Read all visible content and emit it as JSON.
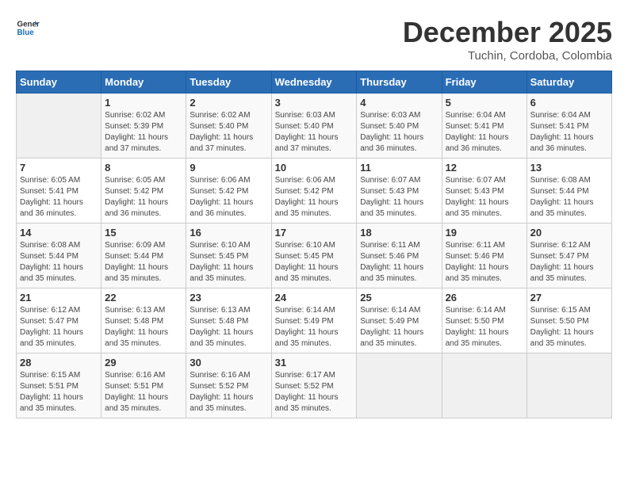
{
  "header": {
    "logo_line1": "General",
    "logo_line2": "Blue",
    "month": "December 2025",
    "location": "Tuchin, Cordoba, Colombia"
  },
  "weekdays": [
    "Sunday",
    "Monday",
    "Tuesday",
    "Wednesday",
    "Thursday",
    "Friday",
    "Saturday"
  ],
  "weeks": [
    [
      {
        "day": "",
        "empty": true
      },
      {
        "day": "1",
        "sunrise": "6:02 AM",
        "sunset": "5:39 PM",
        "daylight": "11 hours and 37 minutes."
      },
      {
        "day": "2",
        "sunrise": "6:02 AM",
        "sunset": "5:40 PM",
        "daylight": "11 hours and 37 minutes."
      },
      {
        "day": "3",
        "sunrise": "6:03 AM",
        "sunset": "5:40 PM",
        "daylight": "11 hours and 37 minutes."
      },
      {
        "day": "4",
        "sunrise": "6:03 AM",
        "sunset": "5:40 PM",
        "daylight": "11 hours and 36 minutes."
      },
      {
        "day": "5",
        "sunrise": "6:04 AM",
        "sunset": "5:41 PM",
        "daylight": "11 hours and 36 minutes."
      },
      {
        "day": "6",
        "sunrise": "6:04 AM",
        "sunset": "5:41 PM",
        "daylight": "11 hours and 36 minutes."
      }
    ],
    [
      {
        "day": "7",
        "sunrise": "6:05 AM",
        "sunset": "5:41 PM",
        "daylight": "11 hours and 36 minutes."
      },
      {
        "day": "8",
        "sunrise": "6:05 AM",
        "sunset": "5:42 PM",
        "daylight": "11 hours and 36 minutes."
      },
      {
        "day": "9",
        "sunrise": "6:06 AM",
        "sunset": "5:42 PM",
        "daylight": "11 hours and 36 minutes."
      },
      {
        "day": "10",
        "sunrise": "6:06 AM",
        "sunset": "5:42 PM",
        "daylight": "11 hours and 35 minutes."
      },
      {
        "day": "11",
        "sunrise": "6:07 AM",
        "sunset": "5:43 PM",
        "daylight": "11 hours and 35 minutes."
      },
      {
        "day": "12",
        "sunrise": "6:07 AM",
        "sunset": "5:43 PM",
        "daylight": "11 hours and 35 minutes."
      },
      {
        "day": "13",
        "sunrise": "6:08 AM",
        "sunset": "5:44 PM",
        "daylight": "11 hours and 35 minutes."
      }
    ],
    [
      {
        "day": "14",
        "sunrise": "6:08 AM",
        "sunset": "5:44 PM",
        "daylight": "11 hours and 35 minutes."
      },
      {
        "day": "15",
        "sunrise": "6:09 AM",
        "sunset": "5:44 PM",
        "daylight": "11 hours and 35 minutes."
      },
      {
        "day": "16",
        "sunrise": "6:10 AM",
        "sunset": "5:45 PM",
        "daylight": "11 hours and 35 minutes."
      },
      {
        "day": "17",
        "sunrise": "6:10 AM",
        "sunset": "5:45 PM",
        "daylight": "11 hours and 35 minutes."
      },
      {
        "day": "18",
        "sunrise": "6:11 AM",
        "sunset": "5:46 PM",
        "daylight": "11 hours and 35 minutes."
      },
      {
        "day": "19",
        "sunrise": "6:11 AM",
        "sunset": "5:46 PM",
        "daylight": "11 hours and 35 minutes."
      },
      {
        "day": "20",
        "sunrise": "6:12 AM",
        "sunset": "5:47 PM",
        "daylight": "11 hours and 35 minutes."
      }
    ],
    [
      {
        "day": "21",
        "sunrise": "6:12 AM",
        "sunset": "5:47 PM",
        "daylight": "11 hours and 35 minutes."
      },
      {
        "day": "22",
        "sunrise": "6:13 AM",
        "sunset": "5:48 PM",
        "daylight": "11 hours and 35 minutes."
      },
      {
        "day": "23",
        "sunrise": "6:13 AM",
        "sunset": "5:48 PM",
        "daylight": "11 hours and 35 minutes."
      },
      {
        "day": "24",
        "sunrise": "6:14 AM",
        "sunset": "5:49 PM",
        "daylight": "11 hours and 35 minutes."
      },
      {
        "day": "25",
        "sunrise": "6:14 AM",
        "sunset": "5:49 PM",
        "daylight": "11 hours and 35 minutes."
      },
      {
        "day": "26",
        "sunrise": "6:14 AM",
        "sunset": "5:50 PM",
        "daylight": "11 hours and 35 minutes."
      },
      {
        "day": "27",
        "sunrise": "6:15 AM",
        "sunset": "5:50 PM",
        "daylight": "11 hours and 35 minutes."
      }
    ],
    [
      {
        "day": "28",
        "sunrise": "6:15 AM",
        "sunset": "5:51 PM",
        "daylight": "11 hours and 35 minutes."
      },
      {
        "day": "29",
        "sunrise": "6:16 AM",
        "sunset": "5:51 PM",
        "daylight": "11 hours and 35 minutes."
      },
      {
        "day": "30",
        "sunrise": "6:16 AM",
        "sunset": "5:52 PM",
        "daylight": "11 hours and 35 minutes."
      },
      {
        "day": "31",
        "sunrise": "6:17 AM",
        "sunset": "5:52 PM",
        "daylight": "11 hours and 35 minutes."
      },
      {
        "day": "",
        "empty": true
      },
      {
        "day": "",
        "empty": true
      },
      {
        "day": "",
        "empty": true
      }
    ]
  ]
}
